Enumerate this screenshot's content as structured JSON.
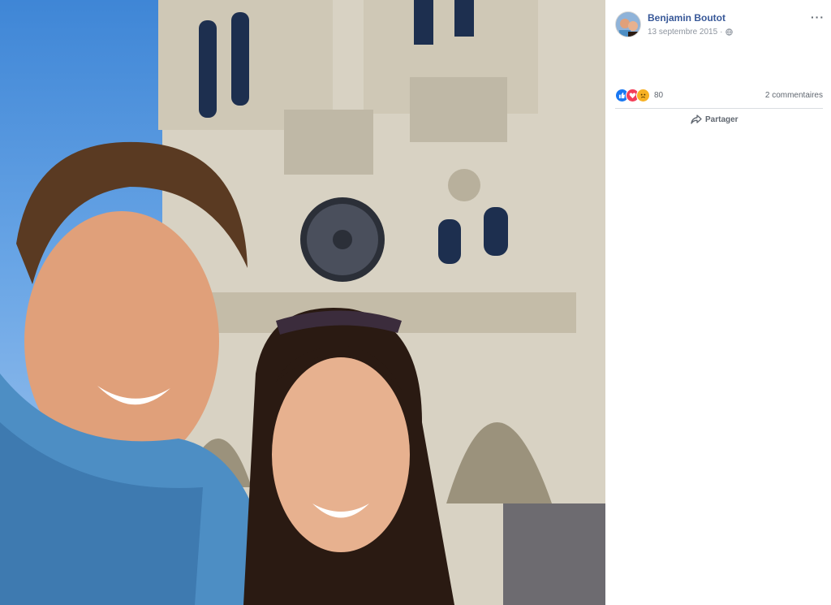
{
  "post": {
    "author": "Benjamin Boutot",
    "date": "13 septembre 2015",
    "separator": "·",
    "privacy_icon": "globe-icon",
    "more_label": "···"
  },
  "reactions": {
    "icons": [
      "like-icon",
      "love-icon",
      "sad-icon"
    ],
    "count": "80",
    "comments": "2 commentaires"
  },
  "actions": {
    "share_label": "Partager",
    "share_icon": "share-arrow-icon"
  },
  "colors": {
    "author_link": "#385898",
    "meta_text": "#8d949e",
    "like": "#1877f2",
    "love": "#f33e58",
    "sad": "#f7b125"
  }
}
